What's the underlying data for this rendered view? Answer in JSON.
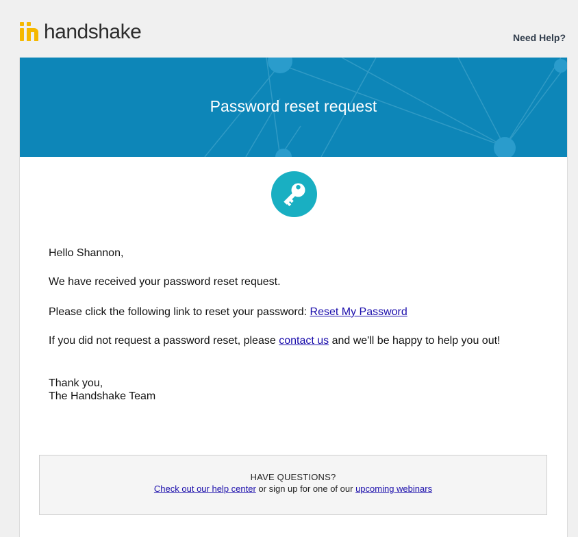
{
  "header": {
    "logo_text": "handshake",
    "need_help": "Need Help?"
  },
  "banner": {
    "title": "Password reset request"
  },
  "email": {
    "greeting": "Hello Shannon,",
    "received": "We have received your password reset request.",
    "instruction_prefix": "Please click the following link to reset your password: ",
    "reset_link": "Reset My Password",
    "not_requested_prefix": "If you did not request a password reset, please ",
    "contact_link": "contact us",
    "not_requested_suffix": " and we'll be happy to help you out!",
    "thanks": "Thank you,",
    "signature": "The Handshake Team"
  },
  "footer": {
    "title": "HAVE QUESTIONS?",
    "help_link": "Check out our help center",
    "middle_text": " or sign up for one of our ",
    "webinars_link": "upcoming webinars"
  },
  "colors": {
    "banner": "#0d86b8",
    "key_circle": "#19afc2",
    "logo_yellow": "#f5b800",
    "link": "#1a0dab"
  },
  "icons": [
    "handshake-logo-icon",
    "key-icon"
  ]
}
